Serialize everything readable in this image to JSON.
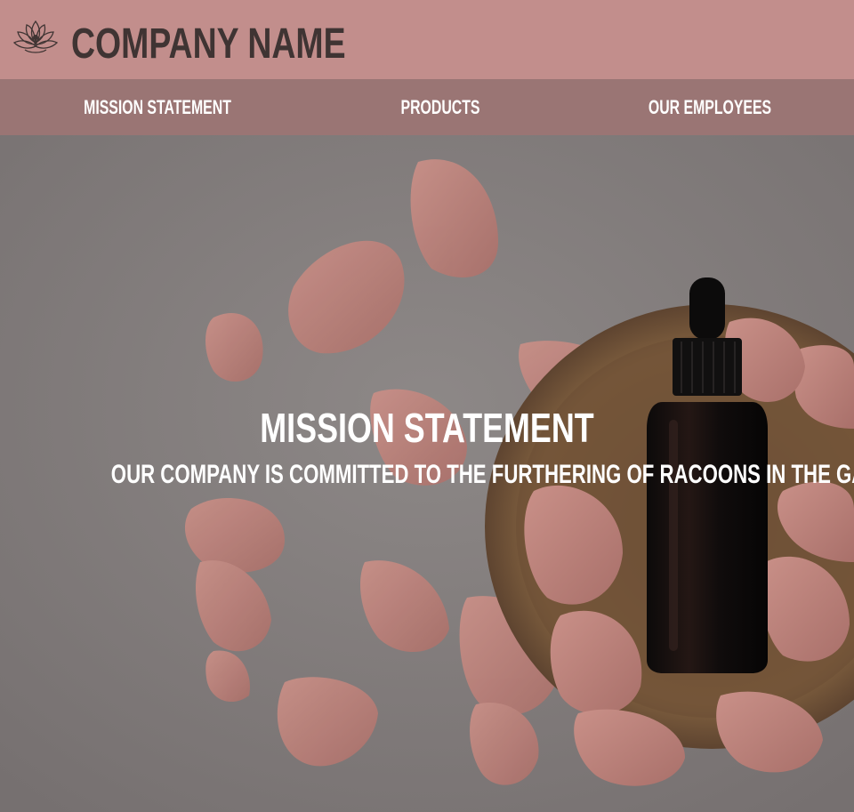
{
  "header": {
    "company_name": "COMPANY NAME",
    "logo_icon": "lotus-icon",
    "background": "#c28e8c",
    "text_color": "#3f3433"
  },
  "nav": {
    "background": "#9a7574",
    "items": [
      {
        "label": "MISSION STATEMENT"
      },
      {
        "label": "PRODUCTS"
      },
      {
        "label": "OUR EMPLOYEES"
      }
    ]
  },
  "hero": {
    "title": "MISSION STATEMENT",
    "text": "OUR COMPANY IS COMMITTED TO THE FURTHERING OF RACOONS IN THE GARBARGE SECTOR.",
    "image_subject": "rose petals with amber dropper bottle on wooden dish"
  }
}
